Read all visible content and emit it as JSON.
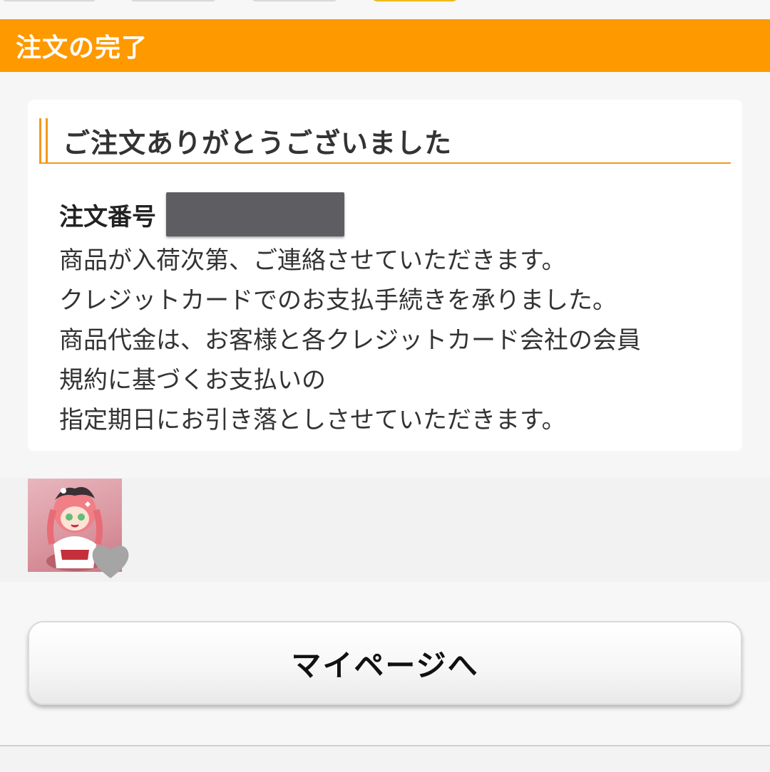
{
  "header": {
    "title": "注文の完了"
  },
  "card": {
    "title": "ご注文ありがとうございました",
    "order_label": "注文番号",
    "lines": [
      "商品が入荷次第、ご連絡させていただきます。",
      "クレジットカードでのお支払手続きを承りました。",
      "商品代金は、お客様と各クレジットカード会社の会員",
      "規約に基づくお支払いの",
      "指定期日にお引き落としさせていただきます。"
    ]
  },
  "item": {
    "thumbnail_icon": "figure-thumbnail-image",
    "favorite_icon": "heart-icon",
    "favorite_color": "#a5a5a5"
  },
  "actions": {
    "mypage_label": "マイページへ"
  },
  "colors": {
    "accent": "#ff9900",
    "title_rule": "#f29a1c"
  }
}
